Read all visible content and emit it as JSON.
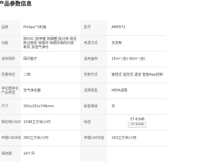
{
  "header": {
    "title": "产品参数信息"
  },
  "rows": [
    {
      "left_label": "品牌",
      "left_value": "Philips/飞利浦",
      "right_label": "型号",
      "right_value": "AMF872"
    },
    {
      "left_label": "功能",
      "left_value": "除VOC 除甲醛 除细菌 除兴味 除花粉过敏原 除烟中 除顺风相风内源 新风 加湿气净化",
      "right_label": "电源方式",
      "right_value": "交流电"
    },
    {
      "left_label": "适用场所",
      "left_value": "探问客厅",
      "right_label": "适用面积",
      "right_value": "15m² (含)-30m² (含)"
    },
    {
      "left_label": "风量档位",
      "left_value": "二档",
      "right_label": "控制方式",
      "right_value": "旋钮式 遥控式 语音 智能App控制"
    },
    {
      "left_label": "净化器净化产品类型",
      "left_value": "空气净化器",
      "right_label": "滤网类型",
      "right_value": "HEPA滤网"
    },
    {
      "left_label": "尺寸",
      "left_value": "291x291x746mm",
      "right_label": "耗能等级",
      "right_value": "无"
    },
    {
      "left_label": "颗粒物CADR值",
      "left_value": "1598立方米/小时",
      "right_label": "噪音",
      "right_value": "37-63dB",
      "right_tag": "37-63dB"
    },
    {
      "left_label": "甲醛CADR值",
      "left_value": "260立方米/小时",
      "right_label": "甲醛CADR值",
      "right_value": "163立方米/小时"
    },
    {
      "left_label": "保修期",
      "left_value": "24个月",
      "right_label": "",
      "right_value": ""
    }
  ]
}
